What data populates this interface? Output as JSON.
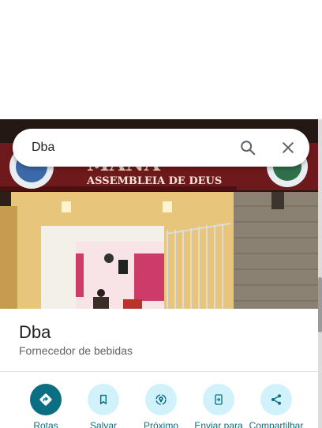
{
  "search": {
    "value": "Dba",
    "search_icon": "search-icon",
    "close_icon": "close-icon"
  },
  "photo": {
    "sign_text": "ASSEMBLEIA DE DEUS",
    "sign_top_text": "MANA"
  },
  "place": {
    "name": "Dba",
    "category": "Fornecedor de bebidas"
  },
  "actions": [
    {
      "label": "Rotas",
      "icon": "directions-icon"
    },
    {
      "label": "Salvar",
      "icon": "bookmark-icon"
    },
    {
      "label": "Próximo",
      "icon": "nearby-icon"
    },
    {
      "label": "Enviar para",
      "icon": "send-to-phone-icon"
    },
    {
      "label": "Compartilhar",
      "icon": "share-icon"
    }
  ],
  "colors": {
    "accent": "#0b6e82",
    "action_bg": "#d2f2fb",
    "text_primary": "#202124",
    "text_secondary": "#5f6368"
  }
}
